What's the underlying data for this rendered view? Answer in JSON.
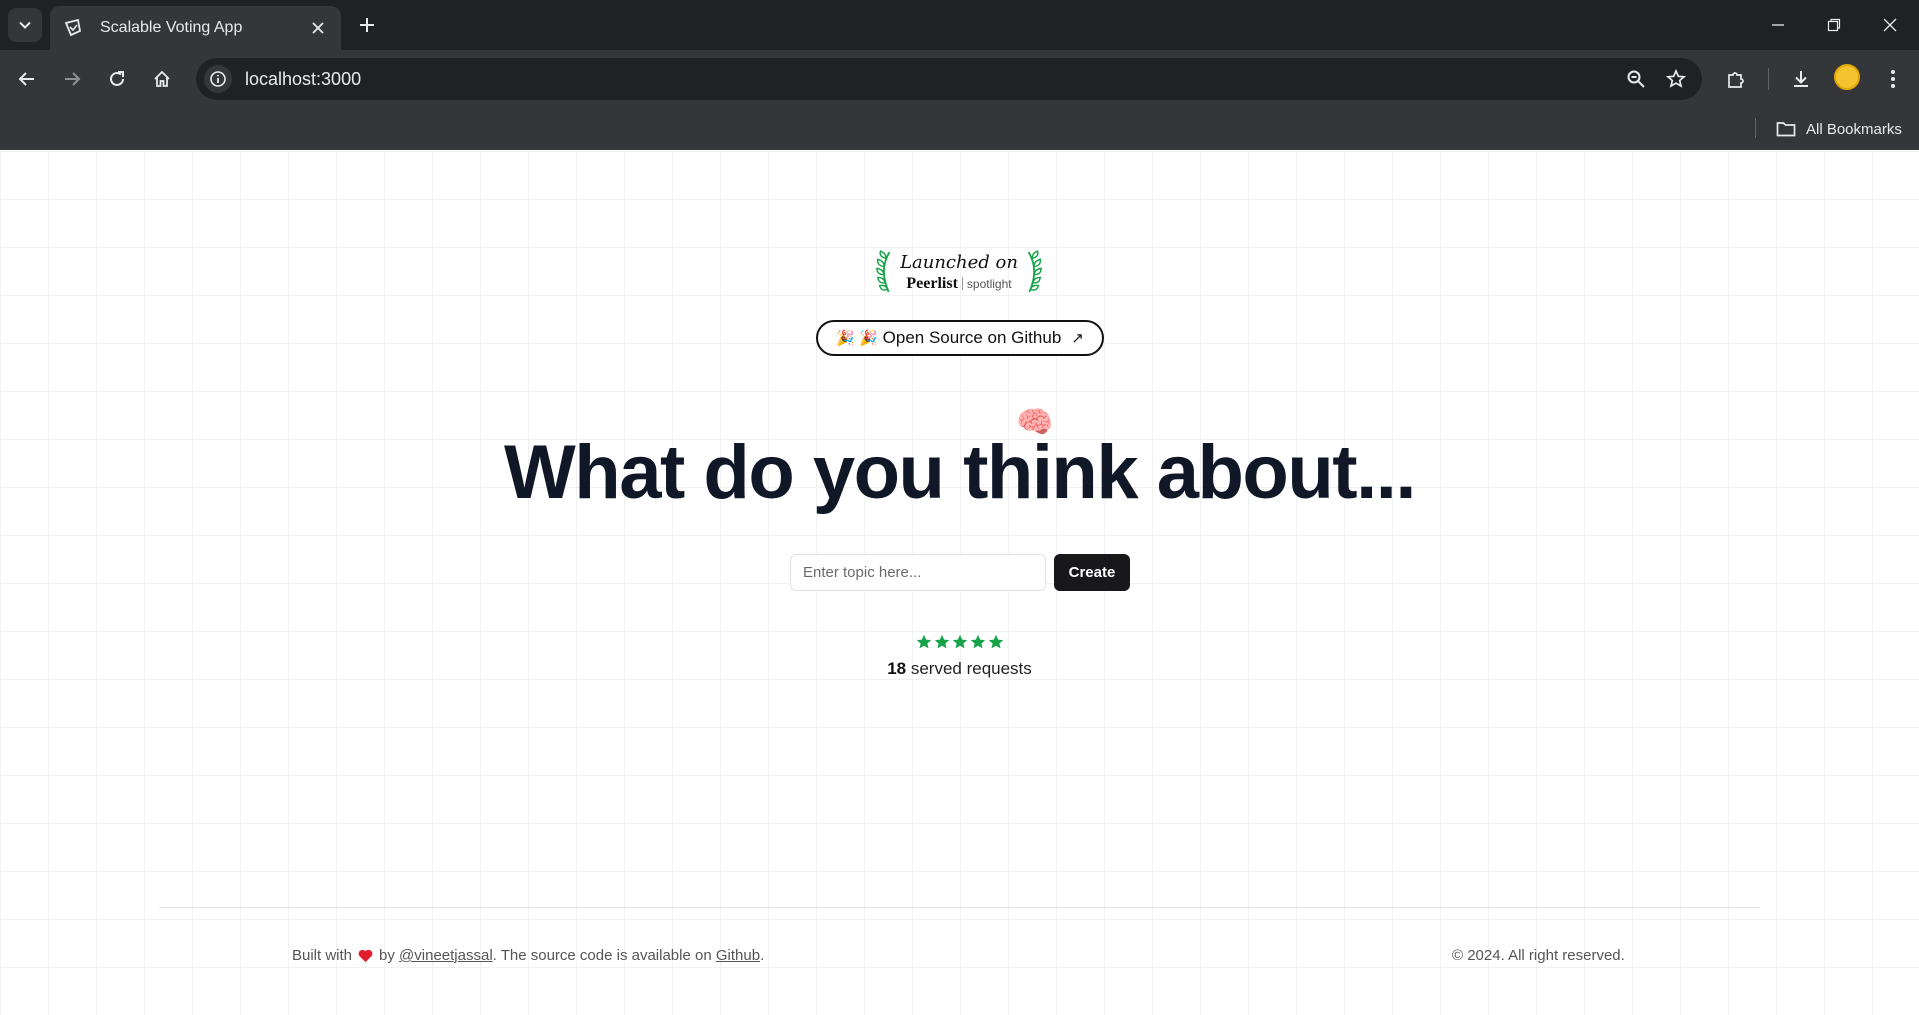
{
  "browser": {
    "tab_title": "Scalable Voting App",
    "url": "localhost:3000",
    "bookmarks_label": "All Bookmarks"
  },
  "page": {
    "badge": {
      "launched": "Launched on",
      "brand": "Peerlist",
      "spotlight": "spotlight"
    },
    "github_pill": {
      "emoji": "🎉 🎉",
      "label": "Open Source on Github",
      "arrow": "↗"
    },
    "brain_emoji": "🧠",
    "headline": "What do you think about...",
    "topic_input": {
      "placeholder": "Enter topic here...",
      "value": ""
    },
    "create_label": "Create",
    "rating": {
      "stars": 5,
      "color": "#16a34a"
    },
    "served": {
      "count": "18",
      "label": " served requests"
    },
    "footer": {
      "built_with": "Built with",
      "by": "by",
      "author": "@vineetjassal",
      "source_text": ". The source code is available on",
      "github_link": "Github",
      "period": ".",
      "copyright": "© 2024. All right reserved."
    }
  }
}
